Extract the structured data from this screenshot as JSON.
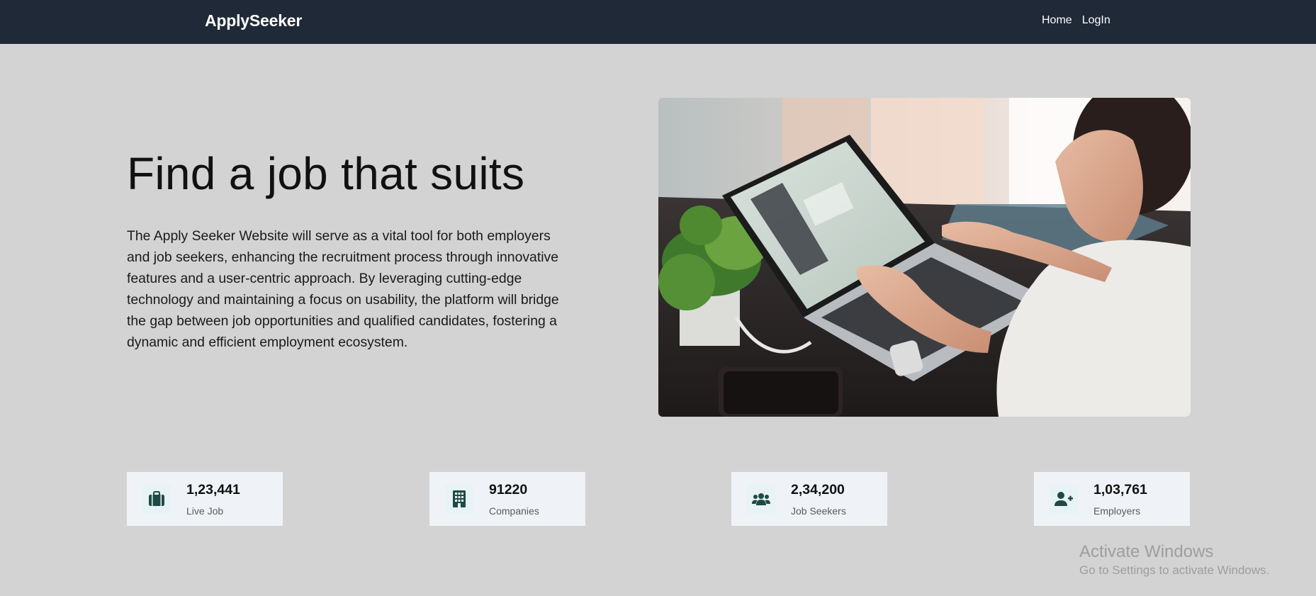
{
  "navbar": {
    "brand": "ApplySeeker",
    "links": [
      {
        "label": "Home"
      },
      {
        "label": "LogIn"
      }
    ]
  },
  "hero": {
    "title": "Find a job that suits",
    "description": "The Apply Seeker Website will serve as a vital tool for both employers and job seekers, enhancing the recruitment process through innovative features and a user-centric approach. By leveraging cutting-edge technology and maintaining a focus on usability, the platform will bridge the gap between job opportunities and qualified candidates, fostering a dynamic and efficient employment ecosystem."
  },
  "stats": [
    {
      "value": "1,23,441",
      "label": "Live Job",
      "icon": "briefcase-icon"
    },
    {
      "value": "91220",
      "label": "Companies",
      "icon": "building-icon"
    },
    {
      "value": "2,34,200",
      "label": "Job Seekers",
      "icon": "users-icon"
    },
    {
      "value": "1,03,761",
      "label": "Employers",
      "icon": "user-plus-icon"
    }
  ],
  "watermark": {
    "title": "Activate Windows",
    "subtitle": "Go to Settings to activate Windows."
  },
  "colors": {
    "navbar_bg": "#1f2937",
    "page_bg": "#d3d3d3",
    "card_bg": "#eff2f7",
    "icon_color": "#1e4a45"
  }
}
